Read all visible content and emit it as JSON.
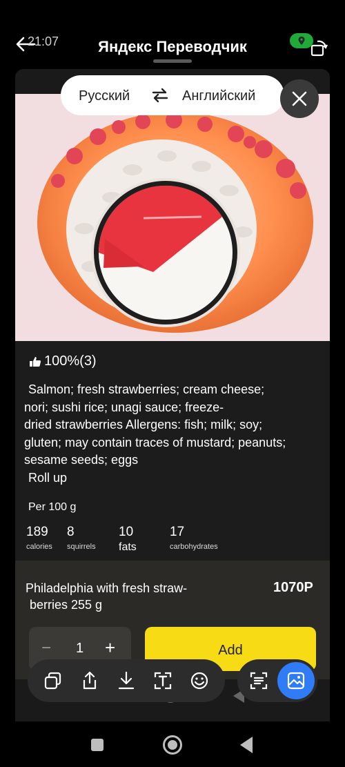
{
  "status": {
    "time": "21:07"
  },
  "header": {
    "title": "Яндекс Переводчик"
  },
  "languages": {
    "source": "Русский",
    "target": "Английский"
  },
  "rating": {
    "text": "100%(3)"
  },
  "description": {
    "lines": [
      "Salmon; fresh strawberries; cream cheese;",
      "nori; sushi rice; unagi sauce; freeze-",
      "dried strawberries Allergens: fish; milk; soy;",
      "gluten; may contain traces of mustard; peanuts;",
      "sesame seeds; eggs",
      "Roll up"
    ]
  },
  "nutrition": {
    "per_label": "Per 100 g",
    "items": [
      {
        "value": "189",
        "label": "calories"
      },
      {
        "value": "8",
        "label": "squirrels"
      },
      {
        "value": "10",
        "label": "fats"
      },
      {
        "value": "17",
        "label": "carbohydrates"
      }
    ]
  },
  "product": {
    "name_line1": "Philadelphia with fresh straw-",
    "name_line2": "berries 255 g",
    "price": "1070P",
    "quantity": "1",
    "minus": "−",
    "plus": "+",
    "add_label": "Add"
  },
  "colors": {
    "accent_yellow": "#f7db14",
    "primary_blue": "#2f7cf6",
    "location_green": "#1faa3a"
  },
  "icons": {
    "toolbar": [
      "copy-icon",
      "share-icon",
      "download-icon",
      "text-format-icon",
      "emoji-icon"
    ],
    "toolbar_right": [
      "text-scan-icon",
      "image-icon"
    ]
  }
}
